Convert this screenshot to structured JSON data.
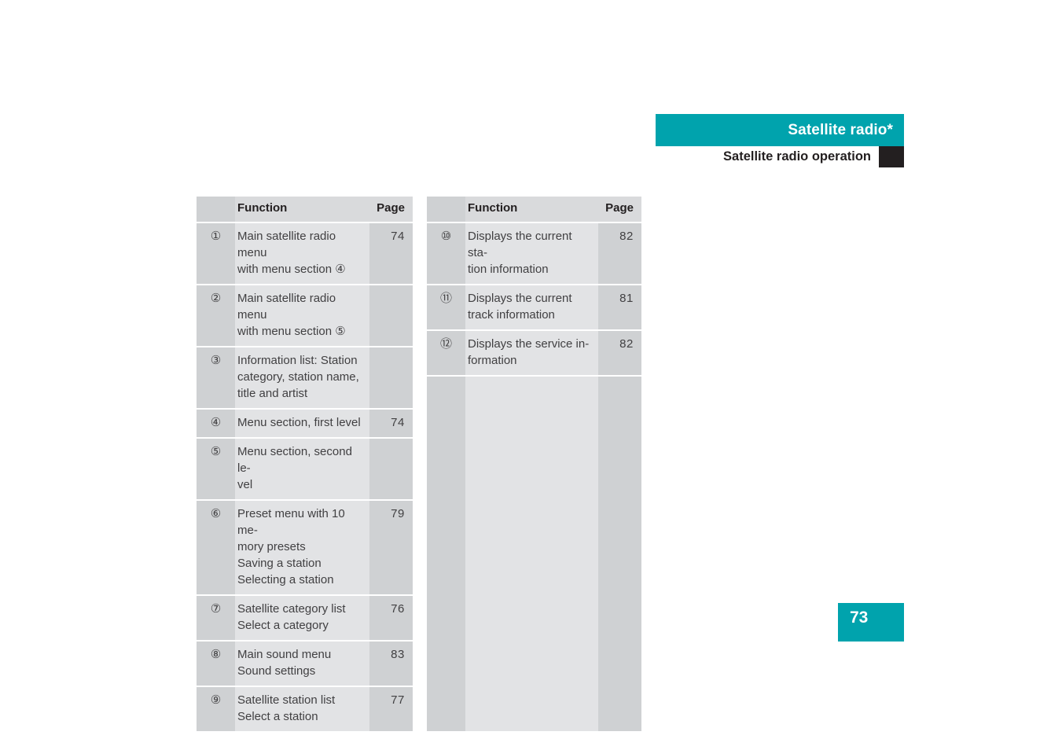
{
  "header": {
    "title": "Satellite radio*",
    "subtitle": "Satellite radio operation",
    "accent_color": "#00a3ad",
    "tab_color": "#231f20"
  },
  "page_badge": {
    "number": "73",
    "color": "#00a3ad"
  },
  "tables": {
    "left": {
      "columns": {
        "number": "",
        "function": "Function",
        "page": "Page"
      },
      "rows": [
        {
          "num": "①",
          "function": "Main satellite radio menu\nwith menu section ④",
          "page": "74"
        },
        {
          "num": "②",
          "function": "Main satellite radio menu\nwith menu section ⑤",
          "page": ""
        },
        {
          "num": "③",
          "function": "Information list: Station\ncategory, station name,\ntitle and artist",
          "page": ""
        },
        {
          "num": "④",
          "function": "Menu section, first level",
          "page": "74"
        },
        {
          "num": "⑤",
          "function": "Menu section, second le-\nvel",
          "page": ""
        },
        {
          "num": "⑥",
          "function": "Preset menu with 10 me-\nmory presets\nSaving a station\nSelecting a station",
          "page": "79"
        },
        {
          "num": "⑦",
          "function": "Satellite category list\nSelect a category",
          "page": "76"
        },
        {
          "num": "⑧",
          "function": "Main sound menu\nSound settings",
          "page": "83"
        },
        {
          "num": "⑨",
          "function": "Satellite station list\nSelect a station",
          "page": "77"
        }
      ]
    },
    "right": {
      "columns": {
        "number": "",
        "function": "Function",
        "page": "Page"
      },
      "rows": [
        {
          "num": "⑩",
          "function": "Displays the current sta-\ntion information",
          "page": "82"
        },
        {
          "num": "⑪",
          "function": "Displays the current\ntrack information",
          "page": "81"
        },
        {
          "num": "⑫",
          "function": "Displays the service in-\nformation",
          "page": "82"
        }
      ],
      "filler": {
        "num": "",
        "function": "",
        "page": ""
      }
    }
  }
}
